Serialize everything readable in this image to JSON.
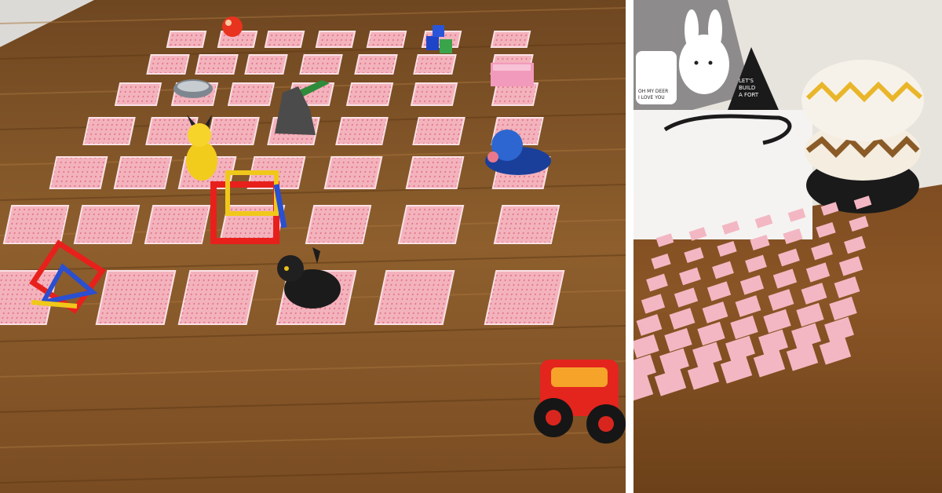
{
  "left_photo": {
    "floor_color": "#8a5a2b",
    "card_color": "#f2a8b4",
    "toys": [
      {
        "name": "red-ball"
      },
      {
        "name": "blue-green-blocks"
      },
      {
        "name": "pink-brick"
      },
      {
        "name": "metal-basket"
      },
      {
        "name": "green-crocodile"
      },
      {
        "name": "grey-block-tower"
      },
      {
        "name": "yellow-pikachu-figure"
      },
      {
        "name": "blue-seal-figure"
      },
      {
        "name": "magnetic-cube"
      },
      {
        "name": "magnetic-triangle-prism"
      },
      {
        "name": "black-cat-figure"
      },
      {
        "name": "red-monster-truck"
      }
    ]
  },
  "right_photo": {
    "floor_color": "#7e4e22",
    "wall_color": "#e9e6e1",
    "card_color": "#f4b8c4",
    "pillow_texts": [
      {
        "text": "OH MY DEER\nI LOVE YOU"
      },
      {
        "text": "LET'S\nBUILD\nA FORT"
      }
    ],
    "bean_bags": [
      "yellow-zigzag",
      "brown-zigzag",
      "black-lattice"
    ]
  }
}
